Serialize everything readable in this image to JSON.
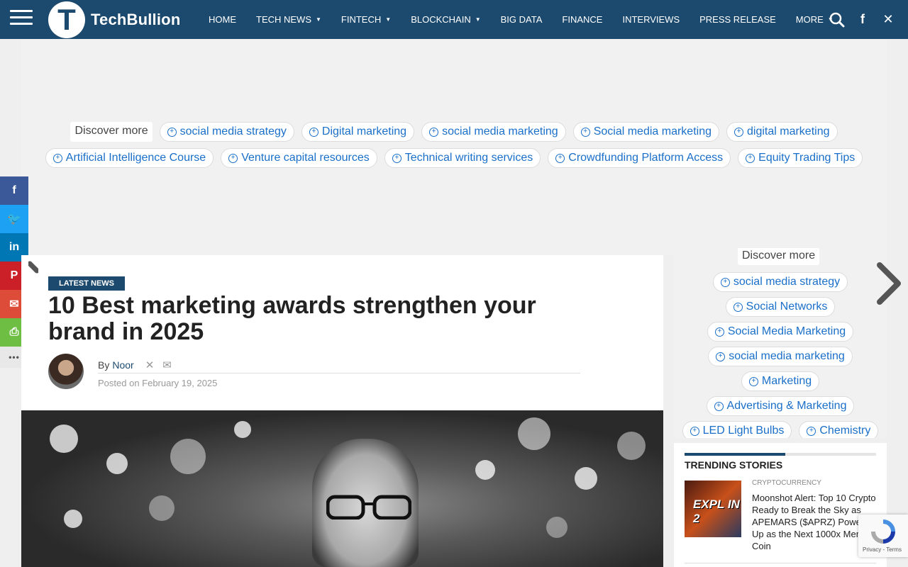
{
  "site": {
    "brand_initial": "T",
    "brand_name": "TechBullion"
  },
  "nav": {
    "items": [
      {
        "label": "HOME",
        "dropdown": false
      },
      {
        "label": "TECH NEWS",
        "dropdown": true
      },
      {
        "label": "FINTECH",
        "dropdown": true
      },
      {
        "label": "BLOCKCHAIN",
        "dropdown": true
      },
      {
        "label": "BIG DATA",
        "dropdown": false
      },
      {
        "label": "FINANCE",
        "dropdown": false
      },
      {
        "label": "INTERVIEWS",
        "dropdown": false
      },
      {
        "label": "PRESS RELEASE",
        "dropdown": false
      },
      {
        "label": "MORE",
        "dropdown": true
      }
    ],
    "icons": [
      "search-icon",
      "facebook-icon",
      "x-icon"
    ]
  },
  "ad": {
    "discover_label": "Discover more",
    "row1": [
      "social media strategy",
      "Digital marketing",
      "social media marketing",
      "Social media marketing",
      "digital marketing"
    ],
    "row2": [
      "Artificial Intelligence Course",
      "Venture capital resources",
      "Technical writing services",
      "Crowdfunding Platform Access",
      "Equity Trading Tips"
    ]
  },
  "share": {
    "buttons": [
      {
        "name": "facebook",
        "glyph": "f",
        "color": "#3b5998"
      },
      {
        "name": "twitter",
        "glyph": "🐦",
        "color": "#1da1f2"
      },
      {
        "name": "linkedin",
        "glyph": "in",
        "color": "#0077b5"
      },
      {
        "name": "pinterest",
        "glyph": "P",
        "color": "#cb2027"
      },
      {
        "name": "email",
        "glyph": "✉",
        "color": "#dd4b39"
      },
      {
        "name": "print",
        "glyph": "⎙",
        "color": "#6ebe44"
      },
      {
        "name": "more",
        "glyph": "•••",
        "color": "#e8e8e8"
      }
    ]
  },
  "article": {
    "category": "LATEST NEWS",
    "title": "10 Best marketing awards strengthen your brand in 2025",
    "by_label": "By",
    "author": "Noor",
    "posted": "Posted on February 19, 2025"
  },
  "sidebar": {
    "discover_label": "Discover more",
    "chips": [
      [
        "social media strategy"
      ],
      [
        "Social Networks"
      ],
      [
        "Social Media Marketing"
      ],
      [
        "social media marketing"
      ],
      [
        "Marketing"
      ],
      [
        "Advertising & Marketing"
      ],
      [
        "LED Light Bulbs",
        "Chemistry"
      ]
    ],
    "trending": {
      "heading": "TRENDING STORIES",
      "image_text": "EXPL IN 2",
      "category": "CRYPTOCURRENCY",
      "headline": "Moonshot Alert: Top 10 Crypto Ready to Break the Sky as APEMARS ($APRZ) Power Up as the Next 1000x Meme Coin"
    }
  },
  "recaptcha": {
    "text": "Privacy - Terms"
  },
  "colors": {
    "brand": "#1c4a6e",
    "link": "#1a6fc9"
  }
}
